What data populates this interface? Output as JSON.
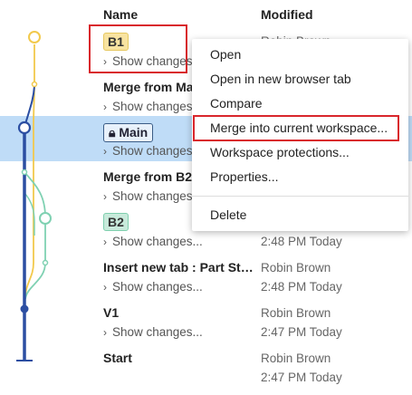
{
  "header": {
    "name": "Name",
    "modified": "Modified"
  },
  "rows": [
    {
      "name": "B1",
      "show": "Show changes...",
      "meta1": "Robin Brown",
      "meta2": ""
    },
    {
      "name": "Merge from Main",
      "show": "Show changes...",
      "meta1": "",
      "meta2": ""
    },
    {
      "name": "Main",
      "show": "Show changes...",
      "meta1": "",
      "meta2": ""
    },
    {
      "name": "Merge from B2",
      "show": "Show changes...",
      "meta1": "",
      "meta2": ""
    },
    {
      "name": "B2",
      "show": "Show changes...",
      "meta1": "",
      "meta2": "2:48 PM Today"
    },
    {
      "name": "Insert new tab : Part Studio",
      "show": "Show changes...",
      "meta1": "Robin Brown",
      "meta2": "2:48 PM Today"
    },
    {
      "name": "V1",
      "show": "Show changes...",
      "meta1": "Robin Brown",
      "meta2": "2:47 PM Today"
    },
    {
      "name": "Start",
      "show": "",
      "meta1": "Robin Brown",
      "meta2": "2:47 PM Today"
    }
  ],
  "menu": {
    "items": [
      "Open",
      "Open in new browser tab",
      "Compare",
      "Merge into current workspace...",
      "Workspace protections...",
      "Properties...",
      "Delete"
    ]
  },
  "icons": {
    "chevron": "chevron-right-icon",
    "lock": "lock-icon"
  },
  "colors": {
    "main_branch": "#2b4ea2",
    "b1_branch": "#f2c94c",
    "b2_branch": "#7fd1b2",
    "highlight": "#bfdcf7",
    "red_box": "#d9262c"
  }
}
